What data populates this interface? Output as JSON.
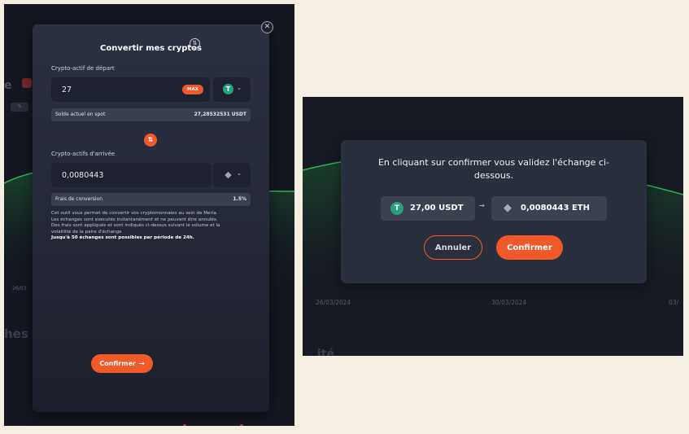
{
  "left": {
    "background": {
      "letter": "e",
      "chip": "%",
      "tick": "26/03",
      "heading": "hes a"
    },
    "modal": {
      "title": "Convertir mes cryptos",
      "title_icon": "swap-vertical-icon",
      "close_icon": "close-icon",
      "from_label": "Crypto-actif de départ",
      "from_amount": "27",
      "max_label": "MAX",
      "from_coin_icon": "tether-icon",
      "balance_label": "Solde actuel en spot",
      "balance_value": "27,28532531 USDT",
      "to_label": "Crypto-actifs d'arrivée",
      "to_amount": "0,0080443",
      "to_coin_icon": "ethereum-icon",
      "fee_label": "Frais de conversion",
      "fee_value": "1.5%",
      "description": [
        "Cet outil vous permet de convertir vos cryptomonnaies au sein de Meria.",
        "Les échanges sont executés instantanément et ne peuvent être annulés.",
        "Des frais sont appliqués et sont indiqués ci-dessus suivant le volume et la",
        "volatilité de la paire d'échange"
      ],
      "description_strong": "Jusqu'à 50 échanges sont possibles par période de 24h.",
      "confirm_label": "Confirmer"
    }
  },
  "right": {
    "background": {
      "ticks": [
        "26/03/2024",
        "30/03/2024",
        "03/"
      ],
      "heading": "ité"
    },
    "dialog": {
      "message": "En cliquant sur confirmer vous validez l'échange ci-dessous.",
      "from_value": "27,00 USDT",
      "to_value": "0,0080443 ETH",
      "cancel_label": "Annuler",
      "confirm_label": "Confirmer"
    }
  },
  "colors": {
    "accent": "#f05a28",
    "tether": "#26a17b",
    "chart_line": "#2fb35a"
  }
}
